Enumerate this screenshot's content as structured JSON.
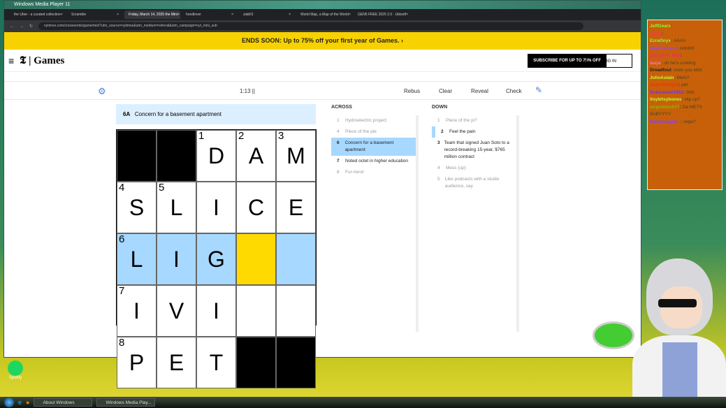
{
  "window": {
    "title": "Windows Media Player 11"
  },
  "tabs": [
    "the Uber - a curated collection",
    "Scramble",
    "Friday, March 14, 2025 the Mini",
    "hoodlover",
    "ziab01",
    "World Map, a Map of the World",
    "GEN5 FREE 2025 2.0 - Ubisoft"
  ],
  "url": "nytimes.com/crosswords/game/mini?utm_source=nytimes&utm_medium=referral&utm_campaign=nyt_mini_sub",
  "banner": "ENDS SOON: Up to 75% off your first year of Games.  ›",
  "header": {
    "logo": "Games",
    "subscribe": "SUBSCRIBE FOR UP TO 75% OFF",
    "login": "LOG IN"
  },
  "toolbar": {
    "timer": "1:13 ||",
    "rebus": "Rebus",
    "clear": "Clear",
    "reveal": "Reveal",
    "check": "Check"
  },
  "active_clue": {
    "num": "6A",
    "text": "Concern for a basement apartment"
  },
  "grid": [
    [
      {
        "b": 1
      },
      {
        "b": 1
      },
      {
        "n": "1",
        "l": "D"
      },
      {
        "n": "2",
        "l": "A"
      },
      {
        "n": "3",
        "l": "M"
      }
    ],
    [
      {
        "n": "4",
        "l": "S"
      },
      {
        "n": "5",
        "l": "L"
      },
      {
        "l": "I"
      },
      {
        "l": "C"
      },
      {
        "l": "E"
      }
    ],
    [
      {
        "n": "6",
        "l": "L",
        "h": 1
      },
      {
        "l": "I",
        "h": 1
      },
      {
        "l": "G",
        "h": 1
      },
      {
        "l": "",
        "s": 1
      },
      {
        "l": "",
        "h": 1
      }
    ],
    [
      {
        "n": "7",
        "l": "I"
      },
      {
        "l": "V"
      },
      {
        "l": "I"
      },
      {
        "l": ""
      },
      {
        "l": ""
      }
    ],
    [
      {
        "n": "8",
        "l": "P"
      },
      {
        "l": "E"
      },
      {
        "l": "T"
      },
      {
        "b": 1
      },
      {
        "b": 1
      }
    ]
  ],
  "across": {
    "title": "ACROSS",
    "items": [
      {
        "n": "1",
        "t": "Hydroelectric project"
      },
      {
        "n": "4",
        "t": "Piece of the pie"
      },
      {
        "n": "6",
        "t": "Concern for a basement apartment",
        "a": 1
      },
      {
        "n": "7",
        "t": "Noted octet in higher education",
        "d": 1
      },
      {
        "n": "8",
        "t": "Fur-riend"
      }
    ]
  },
  "down": {
    "title": "DOWN",
    "items": [
      {
        "n": "1",
        "t": "Piece of the pi?"
      },
      {
        "n": "2",
        "t": "Feel the pain",
        "d": 1
      },
      {
        "n": "3",
        "t": "Team that signed Juan Soto to a record-breaking 15-year, $765 million contract",
        "d": 1
      },
      {
        "n": "4",
        "t": "Mess (up)"
      },
      {
        "n": "5",
        "t": "Like podcasts with a studio audience, say"
      }
    ]
  },
  "chat": [
    {
      "u": "JeffGears",
      "m": "",
      "c": "#7fff3f"
    },
    {
      "u": "c6r1s",
      "m": "",
      "c": "#ff3060"
    },
    {
      "u": "EzraOnyx",
      "m": "AAAA",
      "c": "#7fff3f"
    },
    {
      "u": "HexPrincess",
      "m": "Ahhhh!",
      "c": "#9a40ff"
    },
    {
      "u": "got_click_bait",
      "m": "",
      "c": "#ff2080"
    },
    {
      "u": "laaye",
      "m": "oh he's cooking",
      "c": "#ff70c0"
    },
    {
      "u": "Dreadfoul",
      "m": "mets you idiot",
      "c": "#222"
    },
    {
      "u": "JulioAsiain",
      "m": "Mets?",
      "c": "#c0ff30"
    },
    {
      "u": "nugettiknight",
      "m": "pet",
      "c": "#ff3000"
    },
    {
      "u": "Roboman01851",
      "m": "Shit",
      "c": "#7030ff"
    },
    {
      "u": "itsybitsybones",
      "m": "slip up?",
      "c": "#c0ff30"
    },
    {
      "u": "mrgrimlock77",
      "m": "Da METS BABYYYY",
      "c": "#80c000"
    },
    {
      "u": "Danlateagain_",
      "m": "sega?",
      "c": "#8040ff"
    }
  ],
  "desktop": {
    "spotify": "Spotify"
  },
  "taskbar": [
    "About Windows",
    "Windows Media Play..."
  ]
}
